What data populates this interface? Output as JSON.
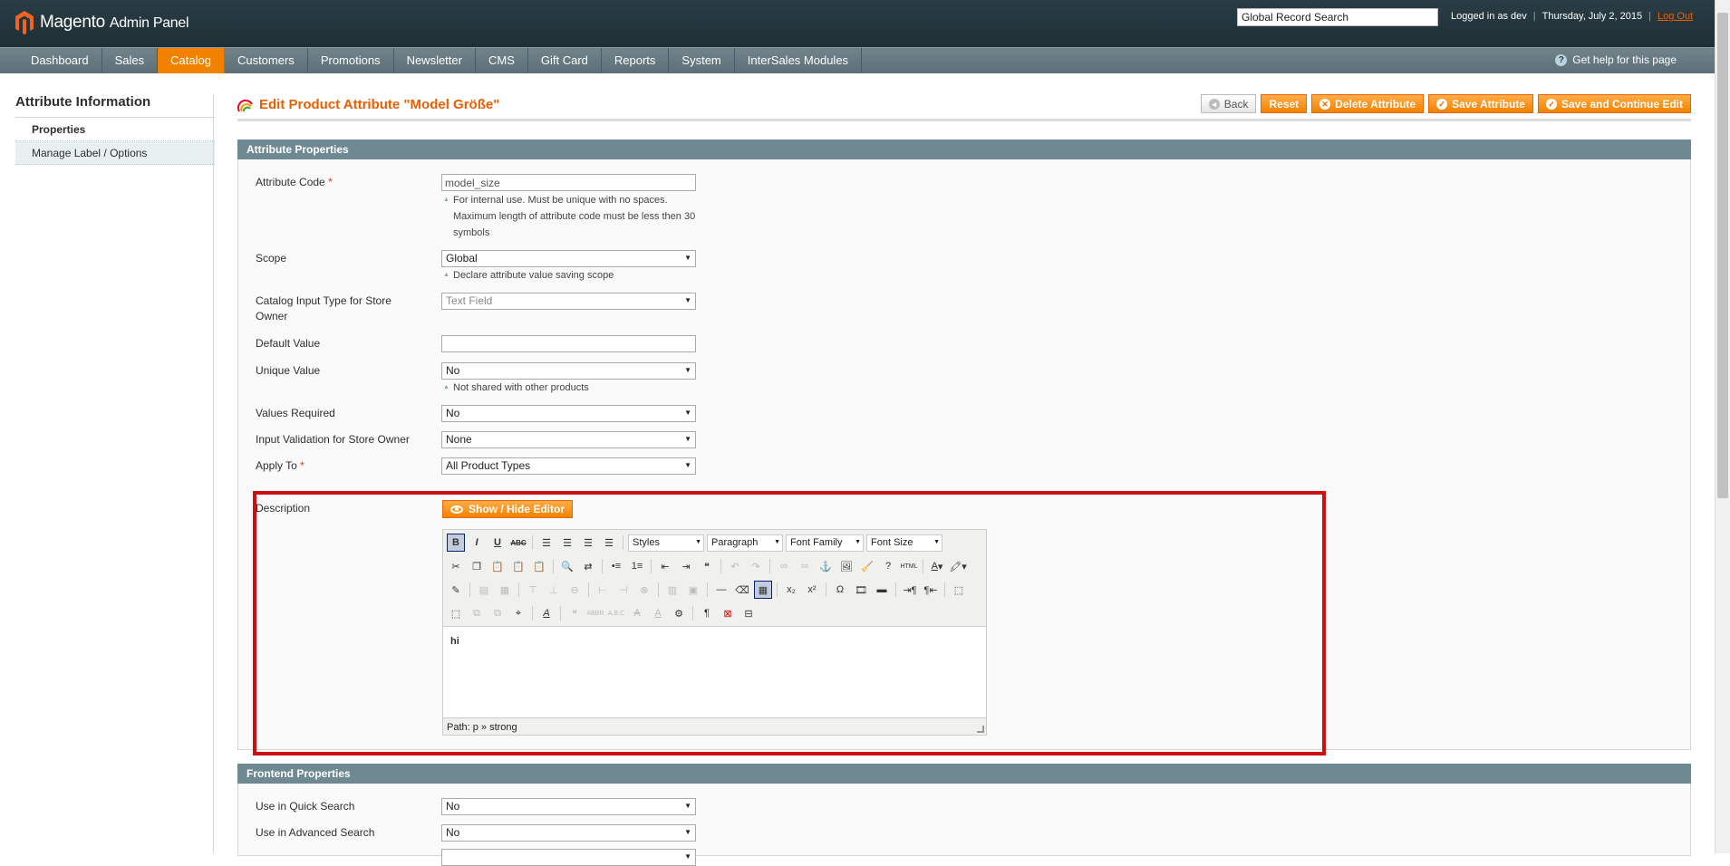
{
  "header": {
    "logo_main": "Magento",
    "logo_sub": "Admin Panel",
    "search_value": "Global Record Search",
    "logged_in": "Logged in as dev",
    "date": "Thursday, July 2, 2015",
    "logout": "Log Out"
  },
  "nav": {
    "items": [
      "Dashboard",
      "Sales",
      "Catalog",
      "Customers",
      "Promotions",
      "Newsletter",
      "CMS",
      "Gift Card",
      "Reports",
      "System",
      "InterSales Modules"
    ],
    "active": "Catalog",
    "help": "Get help for this page"
  },
  "sidebar": {
    "title": "Attribute Information",
    "tabs": [
      "Properties",
      "Manage Label / Options"
    ]
  },
  "page": {
    "title": "Edit Product Attribute \"Model Größe\"",
    "buttons": {
      "back": "Back",
      "reset": "Reset",
      "delete": "Delete Attribute",
      "save": "Save Attribute",
      "save_continue": "Save and Continue Edit"
    }
  },
  "attribute_properties": {
    "heading": "Attribute Properties",
    "attribute_code": {
      "label": "Attribute Code",
      "value": "model_size",
      "note_lines": [
        "For internal use. Must be unique with no spaces.",
        "Maximum length of attribute code must be less then 30",
        "symbols"
      ]
    },
    "scope": {
      "label": "Scope",
      "value": "Global",
      "note": "Declare attribute value saving scope"
    },
    "input_type": {
      "label_lines": [
        "Catalog Input Type for Store",
        "Owner"
      ],
      "value": "Text Field"
    },
    "default_value": {
      "label": "Default Value",
      "value": ""
    },
    "unique_value": {
      "label": "Unique Value",
      "value": "No",
      "note": "Not shared with other products"
    },
    "values_required": {
      "label": "Values Required",
      "value": "No"
    },
    "input_validation": {
      "label": "Input Validation for Store Owner",
      "value": "None"
    },
    "apply_to": {
      "label": "Apply To",
      "value": "All Product Types"
    },
    "description": {
      "label": "Description",
      "show_hide": "Show / Hide Editor",
      "selects": {
        "styles": "Styles",
        "paragraph": "Paragraph",
        "font_family": "Font Family",
        "font_size": "Font Size"
      },
      "content": "hi",
      "path": "Path: p » strong"
    }
  },
  "frontend_properties": {
    "heading": "Frontend Properties",
    "quick_search": {
      "label": "Use in Quick Search",
      "value": "No"
    },
    "advanced_search": {
      "label": "Use in Advanced Search",
      "value": "No"
    }
  },
  "colors": {
    "accent": "#eb5e00",
    "header_bg": "#1e2f35",
    "section_bg": "#6f8992",
    "highlight": "#cc0f0f"
  }
}
